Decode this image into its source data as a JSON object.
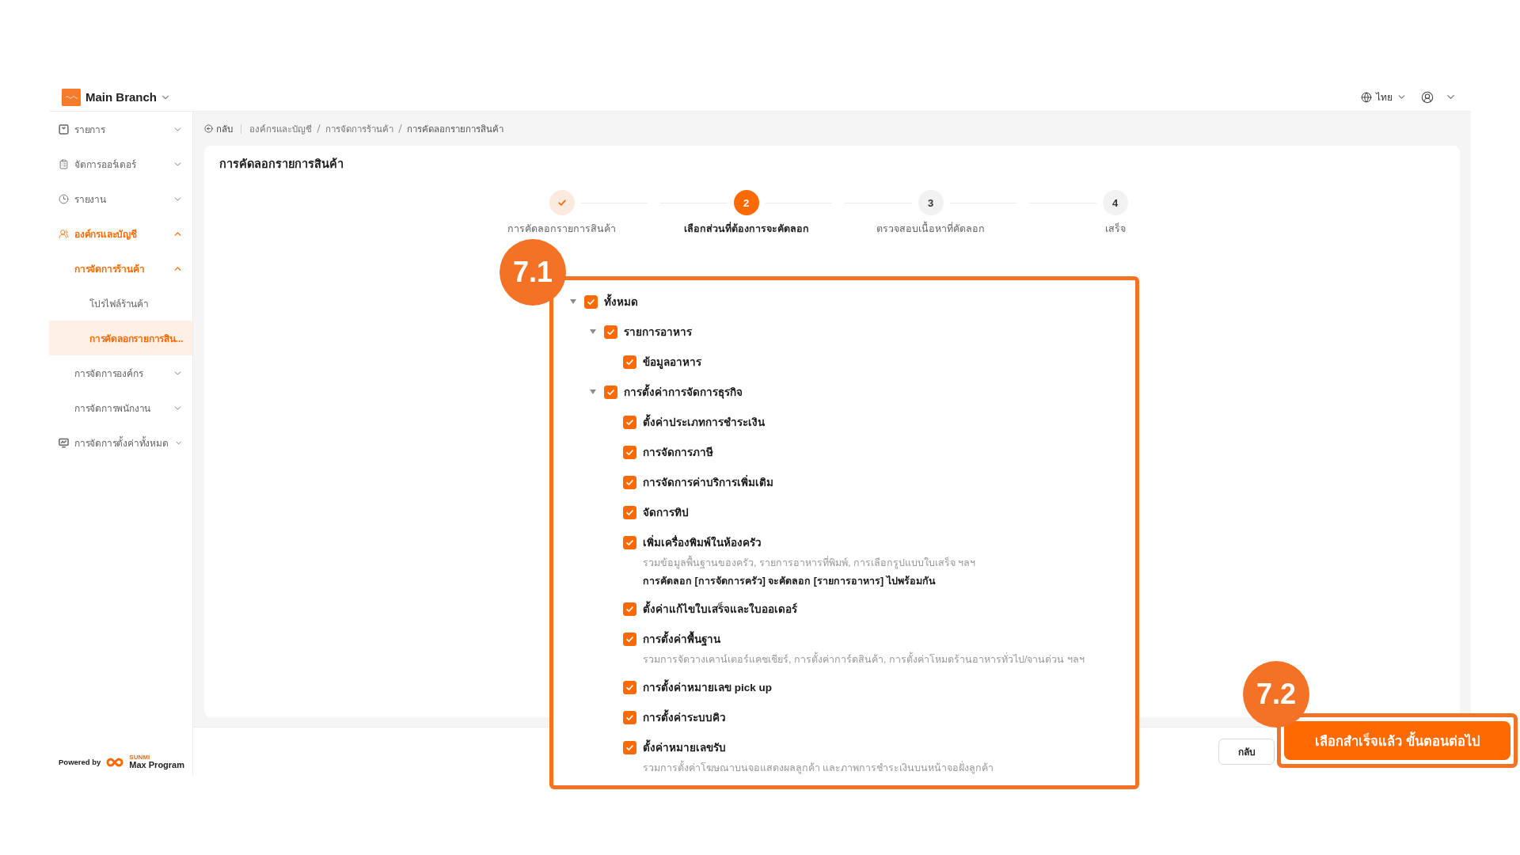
{
  "header": {
    "branch": "Main Branch",
    "language": "ไทย"
  },
  "sidebar": {
    "items": [
      {
        "label": "รายการ",
        "selected": false,
        "expanded": false
      },
      {
        "label": "จัดการออร์เดอร์",
        "selected": false,
        "expanded": false
      },
      {
        "label": "รายงาน",
        "selected": false,
        "expanded": false
      },
      {
        "label": "องค์กรและบัญชี",
        "selected": false,
        "expanded": true,
        "children": [
          {
            "label": "การจัดการร้านค้า",
            "selected": false,
            "expanded": true,
            "children": [
              {
                "label": "โปรไฟล์ร้านค้า",
                "selected": false
              },
              {
                "label": "การคัดลอกรายการสิน...",
                "selected": true
              }
            ]
          },
          {
            "label": "การจัดการองค์กร",
            "selected": false,
            "expanded": false
          },
          {
            "label": "การจัดการพนักงาน",
            "selected": false,
            "expanded": false
          }
        ]
      },
      {
        "label": "การจัดการตั้งค่าทั้งหมด",
        "selected": false,
        "expanded": false
      }
    ],
    "powered_by": {
      "label": "Powered by",
      "brand_small": "SUNMI",
      "brand": "Max Program"
    }
  },
  "breadcrumb": {
    "back": "กลับ",
    "items": [
      "องค์กรและบัญชี",
      "การจัดการร้านค้า",
      "การคัดลอกรายการสินค้า"
    ]
  },
  "page": {
    "title": "การคัดลอกรายการสินค้า",
    "stepper": {
      "steps": [
        {
          "label": "การคัดลอกรายการสินค้า",
          "done": true,
          "active": false
        },
        {
          "number": "2",
          "label": "เลือกส่วนที่ต้องการจะคัดลอก",
          "done": false,
          "active": true
        },
        {
          "number": "3",
          "label": "ตรวจสอบเนื้อหาที่คัดลอก",
          "done": false,
          "active": false
        },
        {
          "number": "4",
          "label": "เสร็จ",
          "done": false,
          "active": false
        }
      ]
    }
  },
  "copy_panel": {
    "annotation": "7.1",
    "tree": [
      {
        "label": "ทั้งหมด",
        "checked": true,
        "expanded": true,
        "children": [
          {
            "label": "รายการอาหาร",
            "checked": true,
            "expanded": true,
            "children": [
              {
                "label": "ข้อมูลอาหาร",
                "checked": true
              }
            ]
          },
          {
            "label": "การตั้งค่าการจัดการธุรกิจ",
            "checked": true,
            "expanded": true,
            "children": [
              {
                "label": "ตั้งค่าประเภทการชำระเงิน",
                "checked": true
              },
              {
                "label": "การจัดการภาษี",
                "checked": true
              },
              {
                "label": "การจัดการค่าบริการเพิ่มเติม",
                "checked": true
              },
              {
                "label": "จัดการทิป",
                "checked": true
              },
              {
                "label": "เพิ่มเครื่องพิมพ์ในห้องครัว",
                "checked": true,
                "description": "รวมข้อมูลพื้นฐานของครัว, รายการอาหารที่พิมพ์, การเลือกรูปแบบใบเสร็จ ฯลฯ",
                "note": "การคัดลอก [การจัดการครัว] จะคัดลอก [รายการอาหาร] ไปพร้อมกัน"
              },
              {
                "label": "ตั้งค่าแก้ไขใบเสร็จและใบออเดอร์",
                "checked": true
              },
              {
                "label": "การตั้งค่าพื้นฐาน",
                "checked": true,
                "description": "รวมการจัดวางเคาน์เตอร์แคชเชียร์, การตั้งค่าการ์ดสินค้า, การตั้งค่าโหมดร้านอาหารทั่วไป/จานด่วน ฯลฯ"
              },
              {
                "label": "การตั้งค่าหมายเลข pick up",
                "checked": true
              },
              {
                "label": "การตั้งค่าระบบคิว",
                "checked": true
              },
              {
                "label": "ตั้งค่าหมายเลขรับ",
                "checked": true,
                "description": "รวมการตั้งค่าโฆษณาบนจอแสดงผลลูกค้า และภาพการชำระเงินบนหน้าจอฝั่งลูกค้า"
              }
            ]
          }
        ]
      }
    ]
  },
  "footer": {
    "back_button": "กลับ",
    "next_button": "เลือกสำเร็จแล้ว ขั้นตอนต่อไป",
    "annotation": "7.2"
  }
}
